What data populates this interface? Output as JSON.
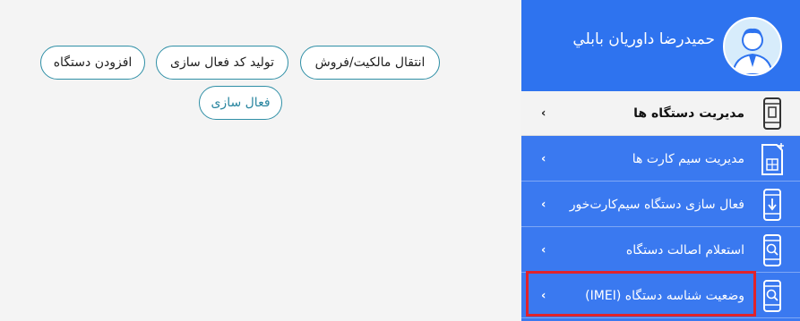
{
  "actions": {
    "transfer_label": "انتقال مالکیت/فروش",
    "generate_code_label": "تولید کد فعال سازی",
    "add_device_label": "افزودن دستگاه",
    "activate_label": "فعال سازی"
  },
  "profile": {
    "name": "حمیدرضا داوریان بابلي",
    "avatar_icon": "user-avatar-icon"
  },
  "menu": {
    "items": [
      {
        "label": "مدیریت دستگاه ها",
        "icon": "phone-device-icon",
        "active": true
      },
      {
        "label": "مدیریت سیم کارت ها",
        "icon": "sim-card-icon",
        "active": false
      },
      {
        "label": "فعال سازی دستگاه سیم‌کارت‌خور",
        "icon": "phone-download-icon",
        "active": false
      },
      {
        "label": "استعلام اصالت دستگاه",
        "icon": "phone-search-icon",
        "active": false
      },
      {
        "label": "وضعیت شناسه دستگاه (IMEI)",
        "icon": "phone-search-icon",
        "active": false
      }
    ]
  },
  "colors": {
    "sidebar_bg": "#3a79f0",
    "active_item_bg": "#f3f3f3",
    "pill_border": "#2f8fa6",
    "highlight": "#e0232b"
  }
}
